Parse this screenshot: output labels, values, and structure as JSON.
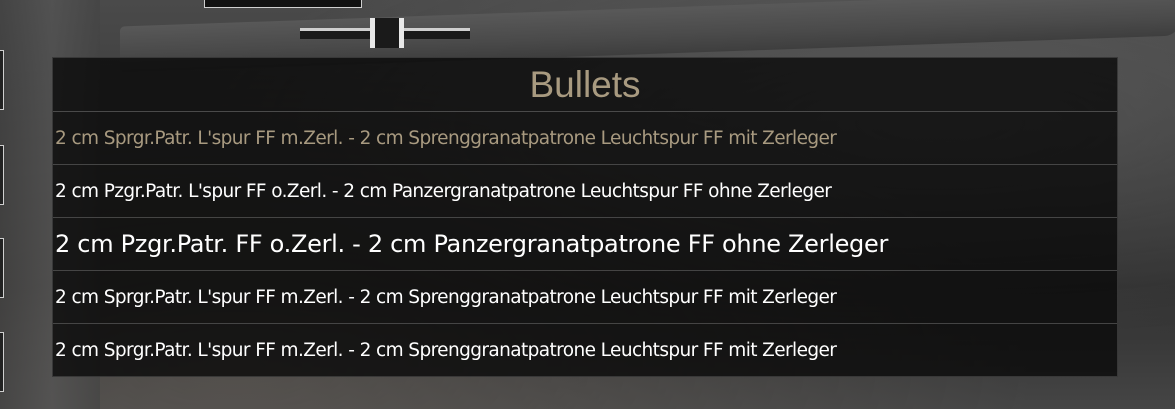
{
  "panel": {
    "title": "Bullets",
    "items": [
      {
        "label": "2 cm Sprgr.Patr. L'spur FF m.Zerl. - 2 cm Sprenggranatpatrone Leuchtspur FF mit Zerleger",
        "state": "selected"
      },
      {
        "label": "2 cm Pzgr.Patr. L'spur FF o.Zerl. - 2 cm Panzergranatpatrone Leuchtspur FF ohne Zerleger",
        "state": "normal"
      },
      {
        "label": "2 cm Pzgr.Patr. FF o.Zerl. - 2 cm Panzergranatpatrone FF ohne Zerleger",
        "state": "hovered"
      },
      {
        "label": "2 cm Sprgr.Patr. L'spur FF m.Zerl. - 2 cm Sprenggranatpatrone Leuchtspur FF mit Zerleger",
        "state": "normal"
      },
      {
        "label": "2 cm Sprgr.Patr. L'spur FF m.Zerl. - 2 cm Sprenggranatpatrone Leuchtspur FF mit Zerleger",
        "state": "normal"
      }
    ]
  },
  "colors": {
    "title": "#a89a80",
    "selected_text": "#a89a80",
    "item_text": "#ffffff",
    "panel_bg": "#080808"
  }
}
